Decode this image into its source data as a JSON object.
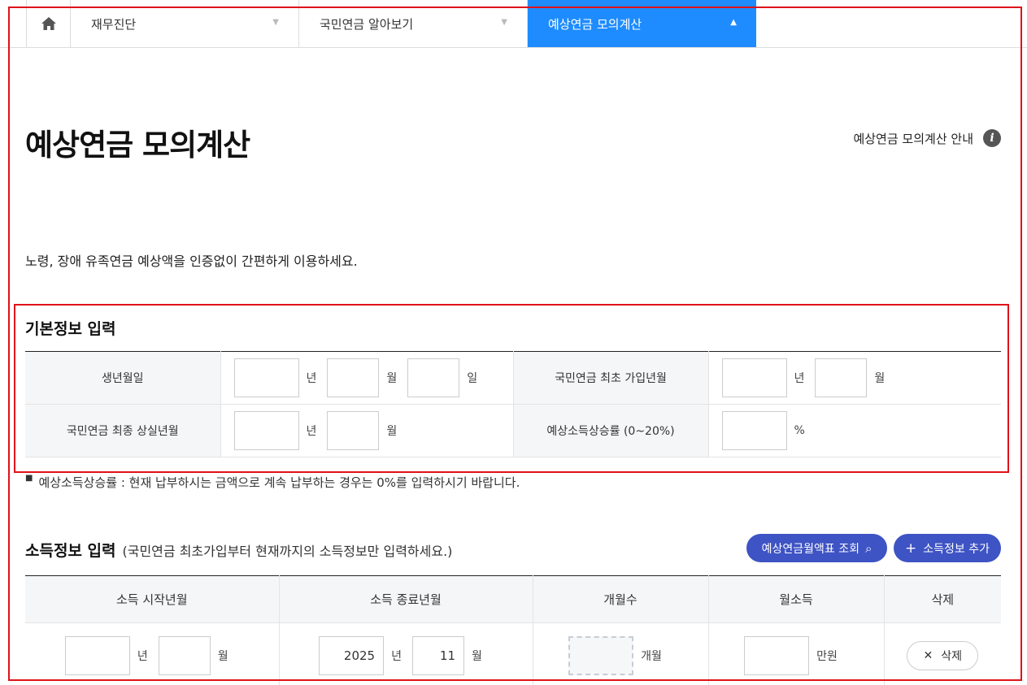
{
  "nav": {
    "home_label": "",
    "items": [
      {
        "label": "재무진단",
        "arrow": "▼"
      },
      {
        "label": "국민연금 알아보기",
        "arrow": "▼"
      },
      {
        "label": "예상연금 모의계산",
        "arrow": "▲"
      }
    ]
  },
  "page": {
    "title": "예상연금 모의계산",
    "guide_link": "예상연금 모의계산 안내",
    "info_glyph": "i",
    "intro": "노령, 장애 유족연금 예상액을 인증없이 간편하게 이용하세요."
  },
  "basic": {
    "title": "기본정보 입력",
    "birth_label": "생년월일",
    "first_join_label": "국민연금 최초 가입년월",
    "last_loss_label": "국민연금 최종 상실년월",
    "growth_label": "예상소득상승률 (0~20%)",
    "unit_year": "년",
    "unit_month": "월",
    "unit_day": "일",
    "unit_percent": "%"
  },
  "note": {
    "bullet": "■",
    "text": "예상소득상승률 : 현재 납부하시는 금액으로 계속 납부하는 경우는 0%를 입력하시기 바랍니다."
  },
  "income": {
    "title": "소득정보 입력",
    "subtitle": "(국민연금 최초가입부터 현재까지의 소득정보만 입력하세요.)",
    "lookup_button": "예상연금월액표 조회",
    "lookup_icon": "⌕",
    "add_button": "소득정보 추가",
    "add_icon": "+",
    "columns": [
      "소득 시작년월",
      "소득 종료년월",
      "개월수",
      "월소득",
      "삭제"
    ],
    "row": {
      "start_year": "",
      "start_month": "",
      "end_year": "2025",
      "end_month": "11",
      "months_unit": "개월",
      "income_unit": "만원",
      "delete_label": "삭제",
      "delete_icon": "✕"
    }
  },
  "colors": {
    "accent": "#1e8cff",
    "button": "#3e53c4",
    "highlight_frame": "#e0121a"
  }
}
